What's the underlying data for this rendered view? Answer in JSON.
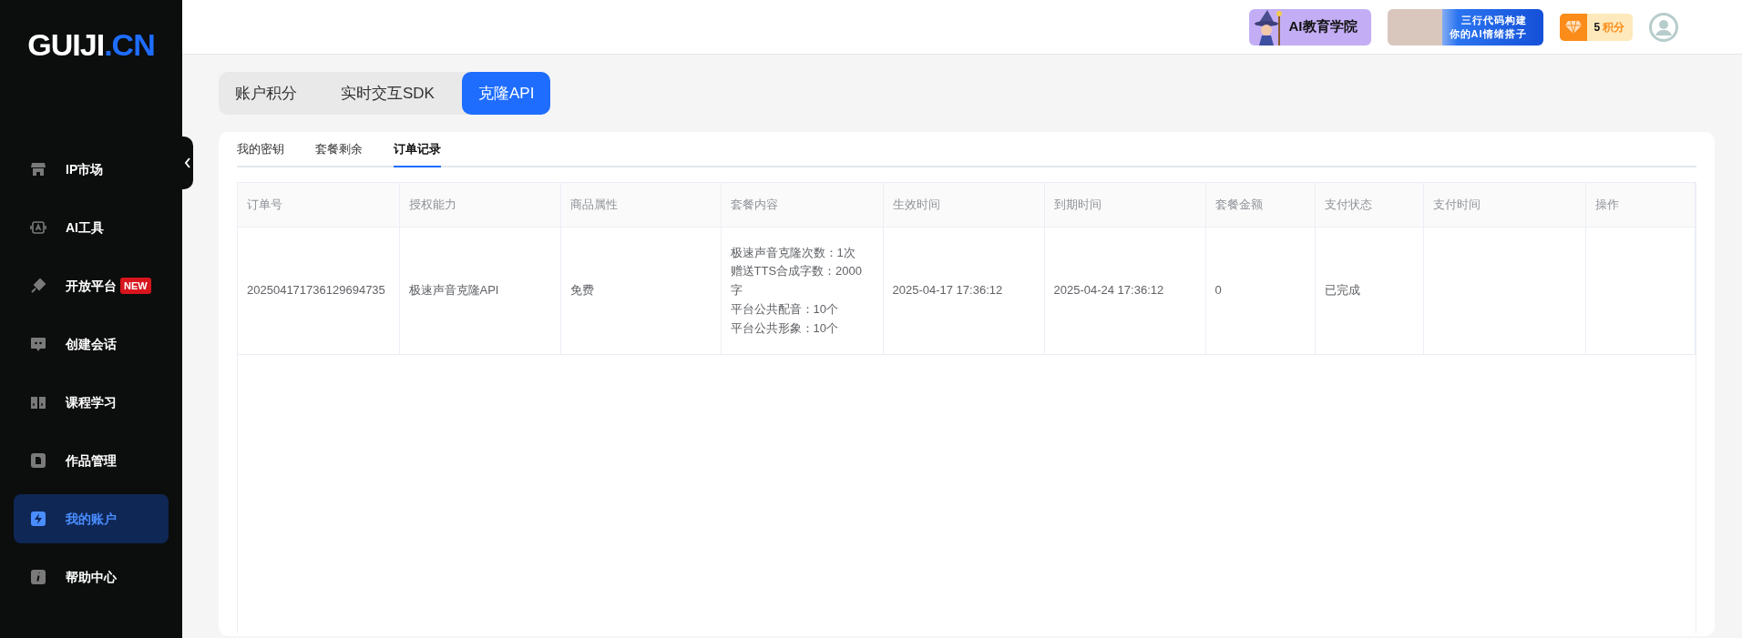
{
  "logo": {
    "text": "GUIJI",
    "suffix": ".CN"
  },
  "sidebar": {
    "items": [
      {
        "label": "IP市场",
        "selected": false
      },
      {
        "label": "AI工具",
        "selected": false
      },
      {
        "label": "开放平台",
        "badge": "NEW",
        "selected": false
      },
      {
        "label": "创建会话",
        "selected": false
      },
      {
        "label": "课程学习",
        "selected": false
      },
      {
        "label": "作品管理",
        "selected": false
      },
      {
        "label": "我的账户",
        "selected": true
      },
      {
        "label": "帮助中心",
        "selected": false
      }
    ]
  },
  "header": {
    "banners": [
      {
        "kind": "academy",
        "lines": [
          "AI教育学院"
        ]
      },
      {
        "kind": "promo",
        "lines": [
          "三行代码构建",
          "你的AI情绪搭子"
        ]
      }
    ],
    "points": {
      "value": "5",
      "unit": "积分"
    }
  },
  "product_tabs": [
    {
      "label": "账户积分",
      "selected": false
    },
    {
      "label": "实时交互SDK",
      "selected": false
    },
    {
      "label": "克隆API",
      "selected": true
    }
  ],
  "sub_tabs": [
    {
      "label": "我的密钥",
      "selected": false
    },
    {
      "label": "套餐剩余",
      "selected": false
    },
    {
      "label": "订单记录",
      "selected": true
    }
  ],
  "table": {
    "columns": [
      "订单号",
      "授权能力",
      "商品属性",
      "套餐内容",
      "生效时间",
      "到期时间",
      "套餐金额",
      "支付状态",
      "支付时间",
      "操作"
    ],
    "rows": [
      {
        "order_no": "202504171736129694735",
        "capability": "极速声音克隆API",
        "attribute": "免费",
        "package_lines": [
          "极速声音克隆次数：1次",
          "赠送TTS合成字数：2000字",
          "平台公共配音：10个",
          "平台公共形象：10个"
        ],
        "start": "2025-04-17 17:36:12",
        "end": "2025-04-24 17:36:12",
        "amount": "0",
        "pay_status": "已完成"
      }
    ]
  }
}
